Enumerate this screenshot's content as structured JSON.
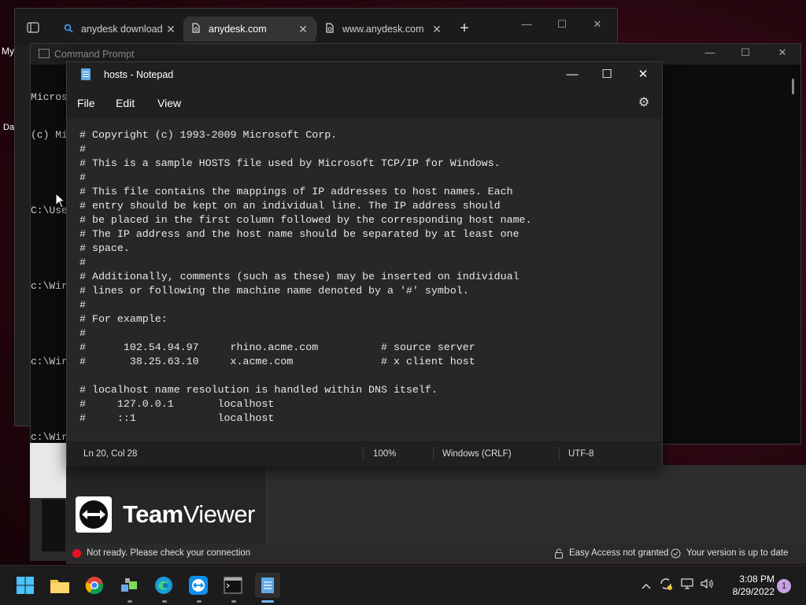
{
  "desktop": {
    "label_1": "My",
    "label_2": "Da"
  },
  "browser": {
    "tabs": [
      {
        "title": "anydesk download",
        "icon": "search-icon",
        "close": "✕"
      },
      {
        "title": "anydesk.com",
        "icon": "page-icon",
        "close": "✕"
      },
      {
        "title": "www.anydesk.com",
        "icon": "page-icon",
        "close": "✕"
      }
    ],
    "new_tab": "+",
    "minimize": "—",
    "maximize": "☐",
    "close": "✕"
  },
  "cmd": {
    "title": "Command Prompt",
    "lines": [
      "Micros",
      "(c) Mi",
      "",
      "C:\\Use",
      "",
      "c:\\Wir",
      "",
      "c:\\Wir",
      "",
      "c:\\Wir"
    ],
    "minimize": "—",
    "maximize": "☐",
    "close": "✕"
  },
  "notepad": {
    "title": "hosts - Notepad",
    "menu": {
      "file": "File",
      "edit": "Edit",
      "view": "View"
    },
    "content": "# Copyright (c) 1993-2009 Microsoft Corp.\n#\n# This is a sample HOSTS file used by Microsoft TCP/IP for Windows.\n#\n# This file contains the mappings of IP addresses to host names. Each\n# entry should be kept on an individual line. The IP address should\n# be placed in the first column followed by the corresponding host name.\n# The IP address and the host name should be separated by at least one\n# space.\n#\n# Additionally, comments (such as these) may be inserted on individual\n# lines or following the machine name denoted by a '#' symbol.\n#\n# For example:\n#\n#      102.54.94.97     rhino.acme.com          # source server\n#       38.25.63.10     x.acme.com              # x client host\n\n# localhost name resolution is handled within DNS itself.\n#     127.0.0.1       localhost\n#     ::1             localhost",
    "status": {
      "position": "Ln 20, Col 28",
      "zoom": "100%",
      "line_ending": "Windows (CRLF)",
      "encoding": "UTF-8"
    },
    "controls": {
      "minimize": "—",
      "maximize": "☐",
      "close": "✕"
    }
  },
  "teamviewer": {
    "brand_bold": "Team",
    "brand_light": "Viewer",
    "status_ready": "Not ready. Please check your connection",
    "easy_access": "Easy Access not granted",
    "version": "Your version is up to date"
  },
  "taskbar": {
    "time": "3:08 PM",
    "date": "8/29/2022",
    "notifications": "1"
  }
}
